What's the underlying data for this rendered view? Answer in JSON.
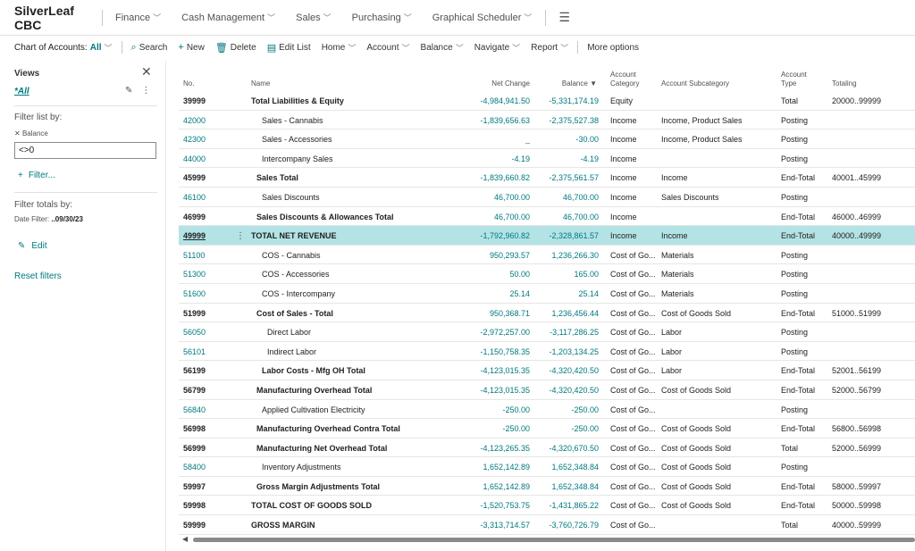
{
  "app": {
    "title": "SilverLeaf CBC"
  },
  "topnav": [
    {
      "label": "Finance"
    },
    {
      "label": "Cash Management"
    },
    {
      "label": "Sales"
    },
    {
      "label": "Purchasing"
    },
    {
      "label": "Graphical Scheduler"
    }
  ],
  "actionbar": {
    "coa_label": "Chart of Accounts:",
    "coa_value": "All",
    "search": "Search",
    "new": "New",
    "delete": "Delete",
    "edit_list": "Edit List",
    "home": "Home",
    "account": "Account",
    "balance": "Balance",
    "navigate": "Navigate",
    "report": "Report",
    "more_options": "More options"
  },
  "leftpane": {
    "views_title": "Views",
    "all_view": "*All",
    "filter_list_by": "Filter list by:",
    "filter_field": "Balance",
    "filter_value": "<>0",
    "add_filter": "Filter...",
    "filter_totals_by": "Filter totals by:",
    "date_filter_label": "Date Filter:",
    "date_filter_value": "..09/30/23",
    "edit": "Edit",
    "reset_filters": "Reset filters"
  },
  "table": {
    "headers": {
      "no": "No.",
      "name": "Name",
      "net_change": "Net Change",
      "balance": "Balance",
      "account_category_1": "Account",
      "account_category_2": "Category",
      "account_subcategory": "Account Subcategory",
      "account_type_1": "Account",
      "account_type_2": "Type",
      "totaling": "Totaling"
    },
    "rows": [
      {
        "no": "39999",
        "name": "Total Liabilities & Equity",
        "net": "-4,984,941.50",
        "bal": "-5,331,174.19",
        "cat": "Equity",
        "sub": "",
        "type": "Total",
        "tot": "20000..99999",
        "style": "total",
        "indent": 0
      },
      {
        "no": "42000",
        "name": "Sales - Cannabis",
        "net": "-1,839,656.63",
        "bal": "-2,375,527.38",
        "cat": "Income",
        "sub": "Income, Product Sales",
        "type": "Posting",
        "tot": "",
        "style": "posting",
        "indent": 2
      },
      {
        "no": "42300",
        "name": "Sales - Accessories",
        "net": "_",
        "bal": "-30.00",
        "cat": "Income",
        "sub": "Income, Product Sales",
        "type": "Posting",
        "tot": "",
        "style": "posting",
        "indent": 2
      },
      {
        "no": "44000",
        "name": "Intercompany Sales",
        "net": "-4.19",
        "bal": "-4.19",
        "cat": "Income",
        "sub": "",
        "type": "Posting",
        "tot": "",
        "style": "posting",
        "indent": 2
      },
      {
        "no": "45999",
        "name": "Sales Total",
        "net": "-1,839,660.82",
        "bal": "-2,375,561.57",
        "cat": "Income",
        "sub": "Income",
        "type": "End-Total",
        "tot": "40001..45999",
        "style": "total",
        "indent": 1
      },
      {
        "no": "46100",
        "name": "Sales Discounts",
        "net": "46,700.00",
        "bal": "46,700.00",
        "cat": "Income",
        "sub": "Sales Discounts",
        "type": "Posting",
        "tot": "",
        "style": "posting",
        "indent": 2
      },
      {
        "no": "46999",
        "name": "Sales Discounts & Allowances Total",
        "net": "46,700.00",
        "bal": "46,700.00",
        "cat": "Income",
        "sub": "",
        "type": "End-Total",
        "tot": "46000..46999",
        "style": "total",
        "indent": 1
      },
      {
        "no": "49999",
        "name": "TOTAL NET REVENUE",
        "net": "-1,792,960.82",
        "bal": "-2,328,861.57",
        "cat": "Income",
        "sub": "Income",
        "type": "End-Total",
        "tot": "40000..49999",
        "style": "total",
        "indent": 0,
        "selected": true
      },
      {
        "no": "51100",
        "name": "COS - Cannabis",
        "net": "950,293.57",
        "bal": "1,236,266.30",
        "cat": "Cost of Go...",
        "sub": "Materials",
        "type": "Posting",
        "tot": "",
        "style": "posting",
        "indent": 2
      },
      {
        "no": "51300",
        "name": "COS - Accessories",
        "net": "50.00",
        "bal": "165.00",
        "cat": "Cost of Go...",
        "sub": "Materials",
        "type": "Posting",
        "tot": "",
        "style": "posting",
        "indent": 2
      },
      {
        "no": "51600",
        "name": "COS - Intercompany",
        "net": "25.14",
        "bal": "25.14",
        "cat": "Cost of Go...",
        "sub": "Materials",
        "type": "Posting",
        "tot": "",
        "style": "posting",
        "indent": 2
      },
      {
        "no": "51999",
        "name": "Cost of Sales - Total",
        "net": "950,368.71",
        "bal": "1,236,456.44",
        "cat": "Cost of Go...",
        "sub": "Cost of Goods Sold",
        "type": "End-Total",
        "tot": "51000..51999",
        "style": "total",
        "indent": 1
      },
      {
        "no": "56050",
        "name": "Direct Labor",
        "net": "-2,972,257.00",
        "bal": "-3,117,286.25",
        "cat": "Cost of Go...",
        "sub": "Labor",
        "type": "Posting",
        "tot": "",
        "style": "posting",
        "indent": 3
      },
      {
        "no": "56101",
        "name": "Indirect Labor",
        "net": "-1,150,758.35",
        "bal": "-1,203,134.25",
        "cat": "Cost of Go...",
        "sub": "Labor",
        "type": "Posting",
        "tot": "",
        "style": "posting",
        "indent": 3
      },
      {
        "no": "56199",
        "name": "Labor Costs - Mfg OH Total",
        "net": "-4,123,015.35",
        "bal": "-4,320,420.50",
        "cat": "Cost of Go...",
        "sub": "Labor",
        "type": "End-Total",
        "tot": "52001..56199",
        "style": "total",
        "indent": 2
      },
      {
        "no": "56799",
        "name": "Manufacturing Overhead Total",
        "net": "-4,123,015.35",
        "bal": "-4,320,420.50",
        "cat": "Cost of Go...",
        "sub": "Cost of Goods Sold",
        "type": "End-Total",
        "tot": "52000..56799",
        "style": "total",
        "indent": 1
      },
      {
        "no": "56840",
        "name": "Applied Cultivation Electricity",
        "net": "-250.00",
        "bal": "-250.00",
        "cat": "Cost of Go...",
        "sub": "",
        "type": "Posting",
        "tot": "",
        "style": "posting",
        "indent": 2
      },
      {
        "no": "56998",
        "name": "Manufacturing Overhead Contra Total",
        "net": "-250.00",
        "bal": "-250.00",
        "cat": "Cost of Go...",
        "sub": "Cost of Goods Sold",
        "type": "End-Total",
        "tot": "56800..56998",
        "style": "total",
        "indent": 1
      },
      {
        "no": "56999",
        "name": "Manufacturing Net Overhead Total",
        "net": "-4,123,265.35",
        "bal": "-4,320,670.50",
        "cat": "Cost of Go...",
        "sub": "Cost of Goods Sold",
        "type": "Total",
        "tot": "52000..56999",
        "style": "total",
        "indent": 1
      },
      {
        "no": "58400",
        "name": "Inventory Adjustments",
        "net": "1,652,142.89",
        "bal": "1,652,348.84",
        "cat": "Cost of Go...",
        "sub": "Cost of Goods Sold",
        "type": "Posting",
        "tot": "",
        "style": "posting",
        "indent": 2
      },
      {
        "no": "59997",
        "name": "Gross Margin Adjustments Total",
        "net": "1,652,142.89",
        "bal": "1,652,348.84",
        "cat": "Cost of Go...",
        "sub": "Cost of Goods Sold",
        "type": "End-Total",
        "tot": "58000..59997",
        "style": "total",
        "indent": 1
      },
      {
        "no": "59998",
        "name": "TOTAL COST OF GOODS SOLD",
        "net": "-1,520,753.75",
        "bal": "-1,431,865.22",
        "cat": "Cost of Go...",
        "sub": "Cost of Goods Sold",
        "type": "End-Total",
        "tot": "50000..59998",
        "style": "total",
        "indent": 0
      },
      {
        "no": "59999",
        "name": "GROSS MARGIN",
        "net": "-3,313,714.57",
        "bal": "-3,760,726.79",
        "cat": "Cost of Go...",
        "sub": "",
        "type": "Total",
        "tot": "40000..59999",
        "style": "total",
        "indent": 0
      }
    ]
  },
  "colors": {
    "accent": "#00787f",
    "selected_row": "#b3e3e5"
  }
}
